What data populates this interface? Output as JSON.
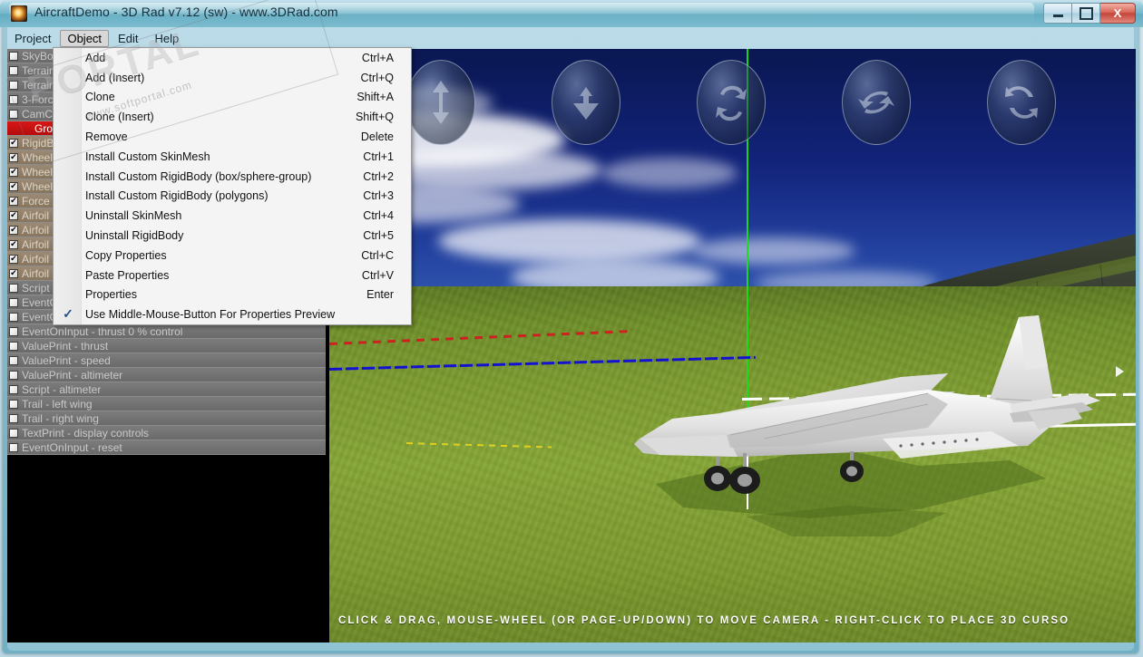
{
  "window": {
    "title": "AircraftDemo - 3D Rad v7.12 (sw) - www.3DRad.com",
    "icon": "app-star-icon",
    "controls": {
      "minimize": "—",
      "maximize": "□",
      "close": "X"
    }
  },
  "menubar": {
    "items": [
      {
        "label": "Project",
        "active": false
      },
      {
        "label": "Object",
        "active": true
      },
      {
        "label": "Edit",
        "active": false
      },
      {
        "label": "Help",
        "active": false
      }
    ]
  },
  "object_menu": {
    "items": [
      {
        "label": "Add",
        "shortcut": "Ctrl+A",
        "checked": false
      },
      {
        "label": "Add (Insert)",
        "shortcut": "Ctrl+Q",
        "checked": false
      },
      {
        "label": "Clone",
        "shortcut": "Shift+A",
        "checked": false
      },
      {
        "label": "Clone (Insert)",
        "shortcut": "Shift+Q",
        "checked": false
      },
      {
        "label": "Remove",
        "shortcut": "Delete",
        "checked": false
      },
      {
        "label": "Install Custom SkinMesh",
        "shortcut": "Ctrl+1",
        "checked": false
      },
      {
        "label": "Install Custom RigidBody (box/sphere-group)",
        "shortcut": "Ctrl+2",
        "checked": false
      },
      {
        "label": "Install Custom RigidBody (polygons)",
        "shortcut": "Ctrl+3",
        "checked": false
      },
      {
        "label": "Uninstall SkinMesh",
        "shortcut": "Ctrl+4",
        "checked": false
      },
      {
        "label": "Uninstall  RigidBody",
        "shortcut": "Ctrl+5",
        "checked": false
      },
      {
        "label": "Copy Properties",
        "shortcut": "Ctrl+C",
        "checked": false
      },
      {
        "label": "Paste Properties",
        "shortcut": "Ctrl+V",
        "checked": false
      },
      {
        "label": "Properties",
        "shortcut": "Enter",
        "checked": false
      },
      {
        "label": "Use Middle-Mouse-Button For Properties Preview",
        "shortcut": "",
        "checked": true
      }
    ]
  },
  "object_list": {
    "rows": [
      {
        "label": "SkyBox",
        "checked": false,
        "theme": "gray"
      },
      {
        "label": "Terrain",
        "checked": false,
        "theme": "gray"
      },
      {
        "label": "Terrain",
        "checked": false,
        "theme": "gray"
      },
      {
        "label": "3-Force",
        "checked": false,
        "theme": "gray"
      },
      {
        "label": "CamChase",
        "checked": false,
        "theme": "gray"
      },
      {
        "label": "Group",
        "checked": false,
        "theme": "selected"
      },
      {
        "label": "RigidBody",
        "checked": true,
        "theme": "tan"
      },
      {
        "label": "Wheel",
        "checked": true,
        "theme": "tan"
      },
      {
        "label": "Wheel",
        "checked": true,
        "theme": "tan"
      },
      {
        "label": "Wheel",
        "checked": true,
        "theme": "tan"
      },
      {
        "label": "Force -",
        "checked": true,
        "theme": "tan"
      },
      {
        "label": "Airfoil -",
        "checked": true,
        "theme": "tan"
      },
      {
        "label": "Airfoil -",
        "checked": true,
        "theme": "tan"
      },
      {
        "label": "Airfoil -",
        "checked": true,
        "theme": "tan"
      },
      {
        "label": "Airfoil -",
        "checked": true,
        "theme": "tan"
      },
      {
        "label": "Airfoil -",
        "checked": true,
        "theme": "tan"
      },
      {
        "label": "Script -",
        "checked": false,
        "theme": "gray"
      },
      {
        "label": "EventOnInput",
        "checked": false,
        "theme": "gray"
      },
      {
        "label": "EventOnInput",
        "checked": false,
        "theme": "gray"
      },
      {
        "label": "EventOnInput - thrust 0 % control",
        "checked": false,
        "theme": "gray"
      },
      {
        "label": "ValuePrint - thrust",
        "checked": false,
        "theme": "gray"
      },
      {
        "label": "ValuePrint - speed",
        "checked": false,
        "theme": "gray"
      },
      {
        "label": "ValuePrint - altimeter",
        "checked": false,
        "theme": "gray"
      },
      {
        "label": "Script - altimeter",
        "checked": false,
        "theme": "gray"
      },
      {
        "label": "Trail - left wing",
        "checked": false,
        "theme": "gray"
      },
      {
        "label": "Trail - right wing",
        "checked": false,
        "theme": "gray"
      },
      {
        "label": "TextPrint - display controls",
        "checked": false,
        "theme": "gray"
      },
      {
        "label": "EventOnInput - reset",
        "checked": false,
        "theme": "gray"
      }
    ],
    "checkmark": "✔"
  },
  "viewport": {
    "gizmos": [
      {
        "name": "move-up-down-gizmo",
        "glyph": "up-down-arrow-icon"
      },
      {
        "name": "move-down-gizmo",
        "glyph": "down-arrow-icon"
      },
      {
        "name": "rotate-pitch-gizmo",
        "glyph": "rotate-arrow-icon"
      },
      {
        "name": "rotate-yaw-gizmo",
        "glyph": "rotate-left-arrow-icon"
      },
      {
        "name": "rotate-roll-gizmo",
        "glyph": "rotate-curve-arrow-icon"
      }
    ],
    "status_text": "CLICK & DRAG, MOUSE-WHEEL (OR PAGE-UP/DOWN) TO MOVE CAMERA - RIGHT-CLICK TO PLACE 3D CURSO",
    "scene": {
      "subject": "low-poly white jet aircraft on green terrain with rocky cliffs and cloudy blue sky",
      "axis_colors": {
        "up": "#17e017",
        "x": "#1212d0",
        "secondary": "#d02020",
        "marker": "#ffffff"
      }
    }
  },
  "watermark": {
    "text": "PORTAL",
    "sub": "www.softportal.com"
  },
  "colors": {
    "titlebar": "#74b6ca",
    "selection": "#d81616",
    "sky": "#12237a",
    "ground": "#86a636",
    "accent": "#26528c"
  }
}
